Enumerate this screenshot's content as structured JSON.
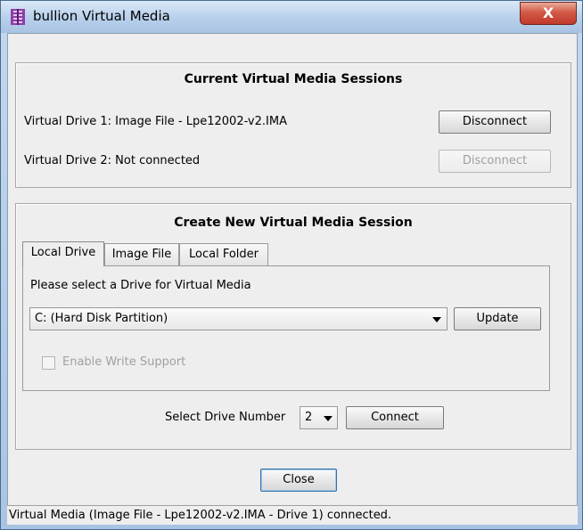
{
  "window": {
    "title": "bullion Virtual Media",
    "close_glyph": "X"
  },
  "current_sessions": {
    "heading": "Current Virtual Media Sessions",
    "drives": [
      {
        "label": "Virtual Drive 1: Image File - Lpe12002-v2.IMA",
        "button": "Disconnect",
        "enabled": true
      },
      {
        "label": "Virtual Drive 2: Not connected",
        "button": "Disconnect",
        "enabled": false
      }
    ]
  },
  "create_session": {
    "heading": "Create New Virtual Media Session",
    "tabs": [
      {
        "label": "Local Drive",
        "active": true
      },
      {
        "label": "Image File",
        "active": false
      },
      {
        "label": "Local Folder",
        "active": false
      }
    ],
    "prompt": "Please select a Drive for Virtual Media",
    "drive_select": {
      "value": "C: (Hard Disk Partition)"
    },
    "update_button": "Update",
    "write_support": {
      "label": "Enable Write Support",
      "checked": false,
      "enabled": false
    },
    "drive_number_label": "Select Drive Number",
    "drive_number_value": "2",
    "connect_button": "Connect"
  },
  "close_button": "Close",
  "status": "Virtual Media (Image File - Lpe12002-v2.IMA - Drive 1) connected.",
  "icons": {
    "app": "bullion-app-icon",
    "close": "close-icon",
    "dropdown": "chevron-down-icon"
  },
  "colors": {
    "close_button": "#c0392b",
    "dialog_bg": "#eeeeee",
    "disabled_text": "#a0a0a0"
  }
}
